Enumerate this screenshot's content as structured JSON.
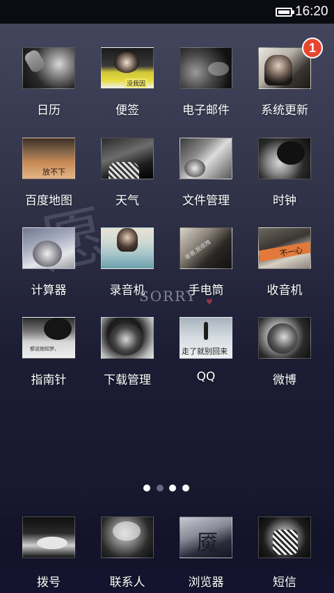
{
  "status_bar": {
    "time": "16:20",
    "battery_icon": "battery-full-icon"
  },
  "wallpaper": {
    "glyph": "愿",
    "word": "SORRY",
    "heart": "♥"
  },
  "apps": [
    {
      "label": "日历"
    },
    {
      "label": "便签",
      "icon_text": "没我因"
    },
    {
      "label": "电子邮件"
    },
    {
      "label": "系统更新",
      "badge": "1"
    },
    {
      "label": "百度地图",
      "icon_text": "放不下"
    },
    {
      "label": "天气"
    },
    {
      "label": "文件管理"
    },
    {
      "label": "时钟"
    },
    {
      "label": "计算器"
    },
    {
      "label": "录音机"
    },
    {
      "label": "手电筒",
      "icon_text": "哥哥,我很拽"
    },
    {
      "label": "收音机",
      "icon_text": "不一心"
    },
    {
      "label": "指南针",
      "icon_text": "都说她知梦。"
    },
    {
      "label": "下载管理"
    },
    {
      "label": "QQ",
      "icon_text": "走了就别回来"
    },
    {
      "label": "微博"
    }
  ],
  "page_indicator": {
    "count": 4,
    "active_index": 0
  },
  "dock": [
    {
      "label": "拨号"
    },
    {
      "label": "联系人"
    },
    {
      "label": "浏览器",
      "icon_text": "魇"
    },
    {
      "label": "短信"
    }
  ],
  "colors": {
    "badge": "#e8452f",
    "status_bar_bg": "#0b0b12",
    "label_text": "#ffffff"
  }
}
